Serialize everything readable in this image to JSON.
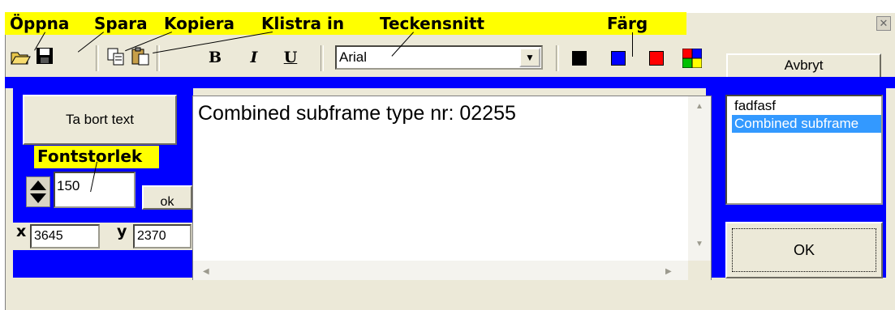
{
  "annotations": {
    "open": "Öppna",
    "save": "Spara",
    "copy": "Kopiera",
    "paste": "Klistra in",
    "font": "Teckensnitt",
    "color": "Färg",
    "font_size": "Fontstorlek"
  },
  "toolbar": {
    "bold": "B",
    "italic": "I",
    "underline": "U",
    "font_value": "Arial",
    "cancel_label": "Avbryt",
    "colors": [
      "#000000",
      "#0000ff",
      "#ff0000",
      "multicolor"
    ]
  },
  "left_panel": {
    "remove_text_label": "Ta bort text",
    "font_size_value": "150",
    "ok_small_label": "ok",
    "x_label": "x",
    "x_value": "3645",
    "y_label": "y",
    "y_value": "2370"
  },
  "editor": {
    "text": "Combined subframe type nr: 02255"
  },
  "list": {
    "items": [
      "fadfasf",
      "Combined subframe"
    ],
    "selected_index": 1
  },
  "ok_label": "OK",
  "accent_colors": {
    "blue": "#0000ff",
    "highlight": "#ffff00",
    "selection": "#3399ff"
  }
}
